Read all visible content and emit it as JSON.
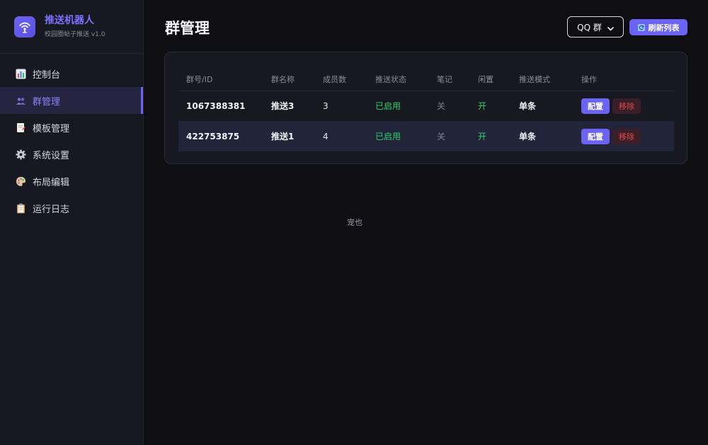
{
  "brand": {
    "title": "推送机器人",
    "subtitle": "校园圈帖子推送 v1.0",
    "accent": "#6b63f3"
  },
  "sidebar": {
    "items": [
      {
        "label": "控制台",
        "icon": "chart-icon",
        "active": false
      },
      {
        "label": "群管理",
        "icon": "users-icon",
        "active": true
      },
      {
        "label": "模板管理",
        "icon": "document-icon",
        "active": false
      },
      {
        "label": "系统设置",
        "icon": "gear-icon",
        "active": false
      },
      {
        "label": "布局编辑",
        "icon": "palette-icon",
        "active": false
      },
      {
        "label": "运行日志",
        "icon": "clipboard-icon",
        "active": false
      }
    ]
  },
  "header": {
    "title": "群管理",
    "group_type_select": {
      "value": "QQ 群"
    },
    "refresh_label": "刷新列表",
    "refresh_icon": "refresh-icon"
  },
  "table": {
    "columns": [
      "群号/ID",
      "群名称",
      "成员数",
      "推送状态",
      "笔记",
      "闲置",
      "推送模式",
      "操作"
    ],
    "rows": [
      {
        "id": "1067388381",
        "name": "推送3",
        "members": "3",
        "status": "已启用",
        "notes": "关",
        "idle": "开",
        "mode": "单条",
        "config_label": "配置",
        "remove_label": "移除"
      },
      {
        "id": "422753875",
        "name": "推送1",
        "members": "4",
        "status": "已启用",
        "notes": "关",
        "idle": "开",
        "mode": "单条",
        "config_label": "配置",
        "remove_label": "移除"
      }
    ]
  },
  "footer_text": "宠也",
  "colors": {
    "enabled": "#2fd16a",
    "remove": "#e5484d",
    "primary": "#6b63f3"
  }
}
